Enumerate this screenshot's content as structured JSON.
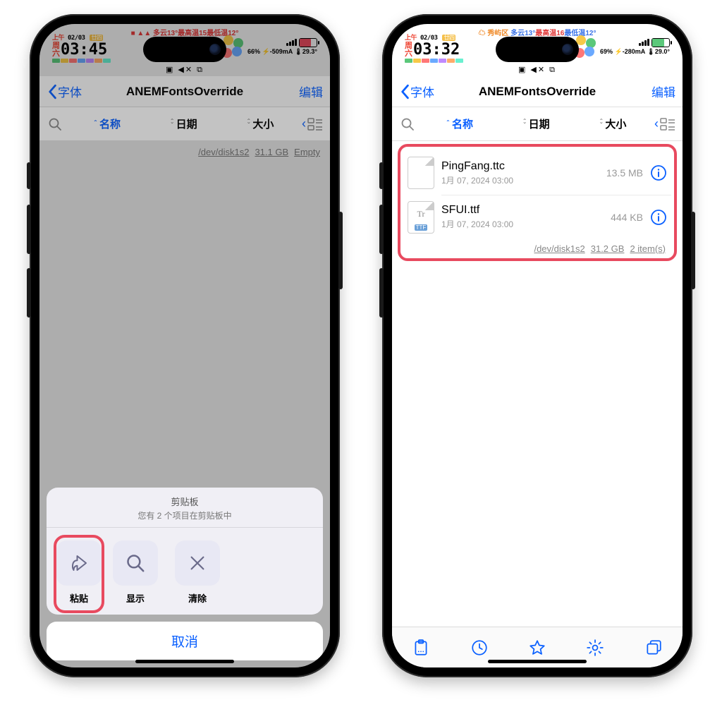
{
  "left": {
    "status_strip": "■ ▲▲ 多云13°最高温15最低温12°",
    "clock_date_prefix": "上午",
    "clock_date": "02/03",
    "clock_badge": "廿四",
    "clock_time": "03:45",
    "battery_pct": "66%",
    "battery_ma": "-509mA",
    "battery_temp": "29.3°",
    "nav_back": "字体",
    "nav_title": "ANEMFontsOverride",
    "nav_edit": "编辑",
    "sort_name": "名称",
    "sort_date": "日期",
    "sort_size": "大小",
    "disk_path": "/dev/disk1s2",
    "disk_size": "31.1 GB",
    "disk_empty": "Empty",
    "sheet_title": "剪贴板",
    "sheet_subtitle": "您有 2 个项目在剪贴板中",
    "act_paste": "粘贴",
    "act_show": "显示",
    "act_clear": "清除",
    "cancel": "取消"
  },
  "right": {
    "status_strip_loc": "秀屿区",
    "status_strip_w": "多云13°",
    "status_strip_hi": "最高温16",
    "status_strip_lo": "最低温12°",
    "clock_date_prefix": "上午",
    "clock_date": "02/03",
    "clock_badge": "廿四",
    "clock_time": "03:32",
    "battery_pct": "69%",
    "battery_ma": "-280mA",
    "battery_temp": "29.0°",
    "nav_back": "字体",
    "nav_title": "ANEMFontsOverride",
    "nav_edit": "编辑",
    "sort_name": "名称",
    "sort_date": "日期",
    "sort_size": "大小",
    "files": [
      {
        "name": "PingFang.ttc",
        "date": "1月 07, 2024 03:00",
        "size": "13.5 MB",
        "tag": ""
      },
      {
        "name": "SFUI.ttf",
        "date": "1月 07, 2024 03:00",
        "size": "444 KB",
        "tag": "TTF"
      }
    ],
    "disk_path": "/dev/disk1s2",
    "disk_size": "31.2 GB",
    "disk_items": "2 item(s)"
  }
}
